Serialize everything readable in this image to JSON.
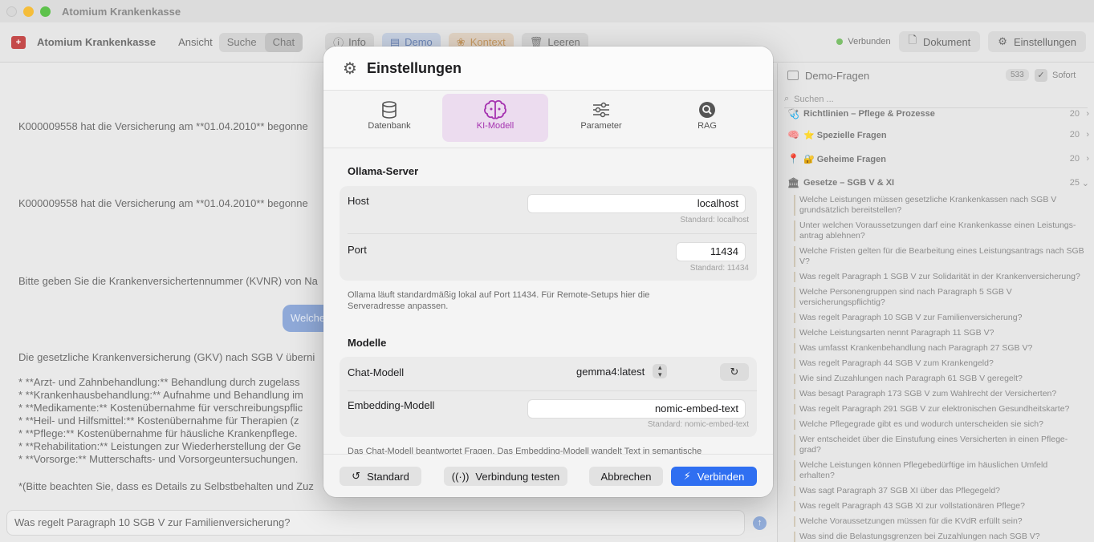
{
  "window": {
    "title": "Atomium Krankenkasse"
  },
  "toolbar": {
    "app_name": "Atomium Krankenkasse",
    "view_label": "Ansicht",
    "segments": [
      "Suche",
      "Chat"
    ],
    "info": "Info",
    "demo": "Demo",
    "kontext": "Kontext",
    "leeren": "Leeren",
    "status": "Verbunden",
    "dokument": "Dokument",
    "einstellungen": "Einstellungen"
  },
  "chat": {
    "messages": [
      "K000009558 hat die Versicherung am **01.04.2010** begonne",
      "K000009558 hat die Versicherung am **01.04.2010** begonne",
      "Bitte geben Sie die Krankenversichertennummer (KVNR) von Na",
      "Die gesetzliche Krankenversicherung (GKV) nach SGB V überni"
    ],
    "bubble": "Welche",
    "bullets": [
      "*   **Arzt- und Zahnbehandlung:** Behandlung durch zugelass",
      "*   **Krankenhausbehandlung:** Aufnahme und Behandlung im",
      "*   **Medikamente:** Kostenübernahme für verschreibungspflic",
      "*   **Heil- und Hilfsmittel:** Kostenübernahme für Therapien (z",
      "*   **Pflege:** Kostenübernahme für häusliche Krankenpflege.",
      "*   **Rehabilitation:** Leistungen zur Wiederherstellung der Ge",
      "*   **Vorsorge:** Mutterschafts- und Vorsorgeuntersuchungen."
    ],
    "footnote": "*(Bitte beachten Sie, dass es Details zu Selbstbehalten und Zuz",
    "input_value": "Was regelt Paragraph 10 SGB V zur Familienversicherung?"
  },
  "sidebar": {
    "title": "Demo-Fragen",
    "count": "533",
    "sofort": "Sofort",
    "search_placeholder": "Suchen ...",
    "categories": [
      {
        "label": "Richtlinien – Pflege & Prozesse",
        "count": "20",
        "icon": "🩺"
      },
      {
        "label": "⭐ Spezielle Fragen",
        "count": "20",
        "icon": "🧠"
      },
      {
        "label": "🔐 Geheime Fragen",
        "count": "20",
        "icon": "📍"
      },
      {
        "label": "Gesetze – SGB V & XI",
        "count": "25",
        "icon": "🏛"
      }
    ],
    "questions": [
      "Welche Leistungen müssen gesetzliche Krankenkassen nach SGB V grundsätzlich bereitstellen?",
      "Unter welchen Voraussetzungen darf eine Krankenkasse einen Leistungs-antrag ablehnen?",
      "Welche Fristen gelten für die Bearbeitung eines Leistungsantrags nach SGB V?",
      "Was regelt Paragraph 1 SGB V zur Solidarität in der Krankenversicherung?",
      "Welche Personengruppen sind nach Paragraph 5 SGB V versicherungspflichtig?",
      "Was regelt Paragraph 10 SGB V zur Familienversicherung?",
      "Welche Leistungsarten nennt Paragraph 11 SGB V?",
      "Was umfasst Krankenbehandlung nach Paragraph 27 SGB V?",
      "Was regelt Paragraph 44 SGB V zum Krankengeld?",
      "Wie sind Zuzahlungen nach Paragraph 61 SGB V geregelt?",
      "Was besagt Paragraph 173 SGB V zum Wahlrecht der Versicherten?",
      "Was regelt Paragraph 291 SGB V zur elektronischen Gesundheitskarte?",
      "Welche Pflegegrade gibt es und wodurch unterscheiden sie sich?",
      "Wer entscheidet über die Einstufung eines Versicherten in einen Pflege-grad?",
      "Welche Leistungen können Pflegebedürftige im häuslichen Umfeld erhalten?",
      "Was sagt Paragraph 37 SGB XI über das Pflegegeld?",
      "Was regelt Paragraph 43 SGB XI zur vollstationären Pflege?",
      "Welche Voraussetzungen müssen für die KVdR erfüllt sein?",
      "Was sind die Belastungsgrenzen bei Zuzahlungen nach SGB V?"
    ]
  },
  "dialog": {
    "title": "Einstellungen",
    "tabs": [
      {
        "label": "Datenbank",
        "icon": "database-icon"
      },
      {
        "label": "KI-Modell",
        "icon": "brain-icon"
      },
      {
        "label": "Parameter",
        "icon": "sliders-icon"
      },
      {
        "label": "RAG",
        "icon": "magnifier-icon"
      }
    ],
    "ollama": {
      "section_title": "Ollama-Server",
      "host_label": "Host",
      "host_value": "localhost",
      "host_hint": "Standard: localhost",
      "port_label": "Port",
      "port_value": "11434",
      "port_hint": "Standard: 11434",
      "note": "Ollama läuft standardmäßig lokal auf Port 11434. Für Remote-Setups hier die Serveradresse anpassen."
    },
    "models": {
      "section_title": "Modelle",
      "chat_label": "Chat-Modell",
      "chat_value": "gemma4:latest",
      "embed_label": "Embedding-Modell",
      "embed_value": "nomic-embed-text",
      "embed_hint": "Standard: nomic-embed-text",
      "note": "Das Chat-Modell beantwortet Fragen. Das Embedding-Modell wandelt Text in semantische"
    },
    "footer": {
      "standard": "Standard",
      "test": "Verbindung testen",
      "cancel": "Abbrechen",
      "connect": "Verbinden"
    }
  },
  "colors": {
    "accent": "#2f6ff1",
    "tab_active_bg": "#ecdcef",
    "tab_active_fg": "#a533b0",
    "status_green": "#7cbf6a"
  }
}
